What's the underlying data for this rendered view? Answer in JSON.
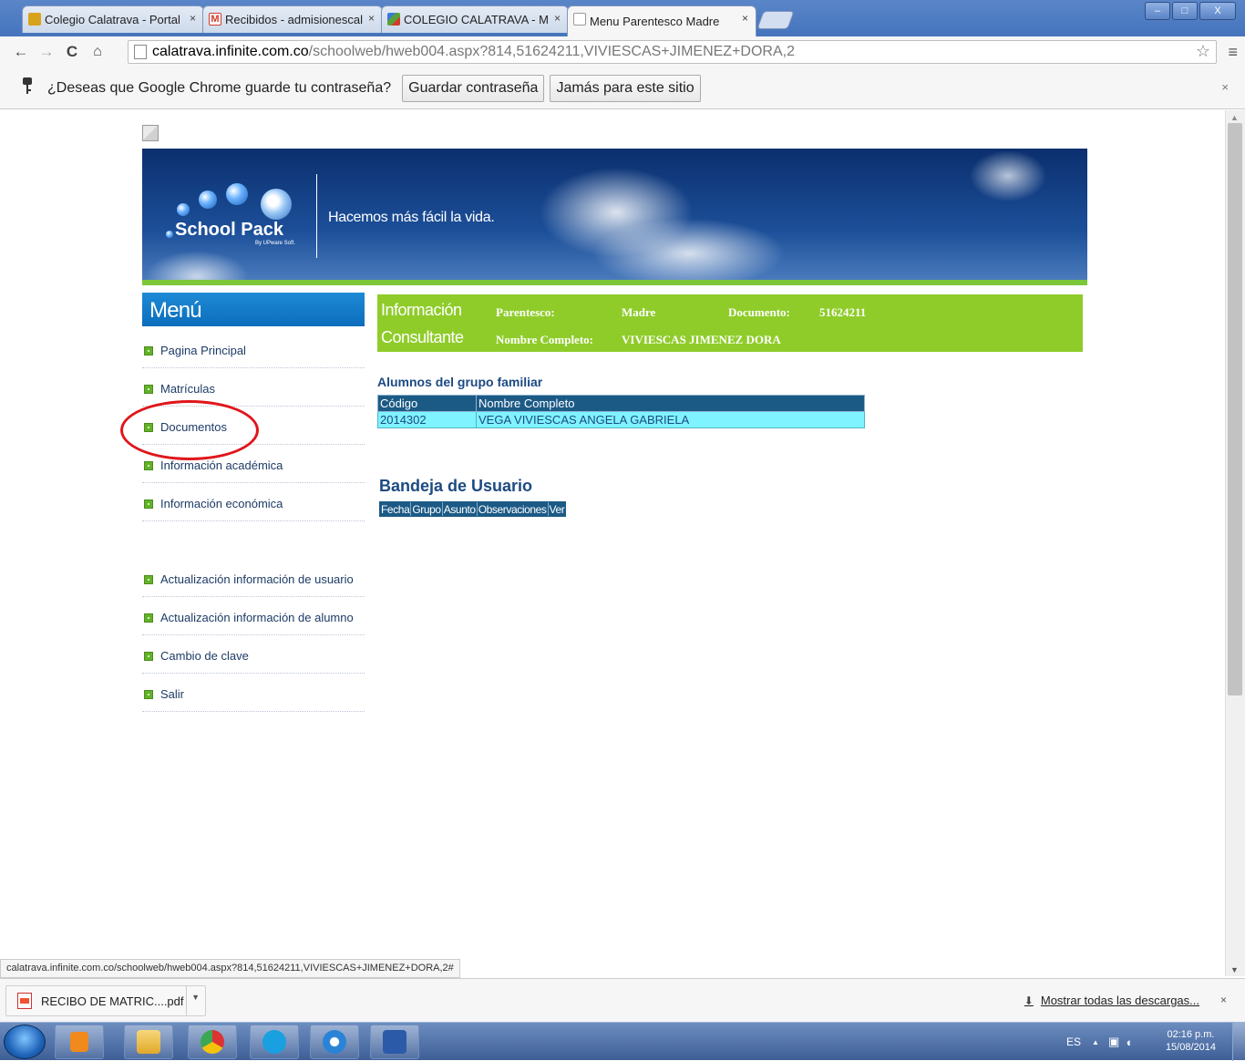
{
  "browser": {
    "tabs": [
      {
        "label": "Colegio Calatrava - Portal",
        "favicon_color": "#d9a21b"
      },
      {
        "label": "Recibidos - admisionescal",
        "favicon_color": "#d23b2a"
      },
      {
        "label": "COLEGIO CALATRAVA - M",
        "favicon_color": "#5aa03a"
      },
      {
        "label": "Menu Parentesco Madre",
        "favicon_color": "#ffffff"
      }
    ],
    "tab_close_glyph": "×",
    "window_buttons": {
      "minimize": "–",
      "maximize": "□",
      "close": "X"
    },
    "url_host": "calatrava.infinite.com.co",
    "url_path": "/schoolweb/hweb004.aspx?814,51624211,VIVIESCAS+JIMENEZ+DORA,2",
    "infobar": {
      "message": "¿Deseas que Google Chrome guarde tu contraseña?",
      "save_label": "Guardar contraseña",
      "never_label": "Jamás para este sitio",
      "close_glyph": "×"
    }
  },
  "banner": {
    "logo_text": "School Pack",
    "logo_sub": "By UPware Soft.",
    "tagline": "Hacemos más fácil la vida."
  },
  "menu": {
    "title": "Menú",
    "items": [
      {
        "label": "Pagina Principal"
      },
      {
        "label": "Matrículas"
      },
      {
        "label": "Documentos"
      },
      {
        "label": "Información académica"
      },
      {
        "label": "Información económica"
      },
      {
        "label": "Actualización información de usuario"
      },
      {
        "label": "Actualización información de alumno"
      },
      {
        "label": "Cambio de clave"
      },
      {
        "label": "Salir"
      }
    ]
  },
  "info": {
    "title_line1": "Información",
    "title_line2": "Consultante",
    "parentesco_label": "Parentesco:",
    "parentesco_value": "Madre",
    "documento_label": "Documento:",
    "documento_value": "51624211",
    "nombre_label": "Nombre Completo:",
    "nombre_value": "VIVIESCAS JIMENEZ DORA"
  },
  "students": {
    "title": "Alumnos del grupo familiar",
    "columns": [
      "Código",
      "Nombre Completo"
    ],
    "rows": [
      [
        "2014302",
        "VEGA VIVIESCAS ANGELA GABRIELA"
      ]
    ]
  },
  "inbox": {
    "title": "Bandeja de Usuario",
    "columns": [
      "Fecha",
      "Grupo",
      "Asunto",
      "Observaciones",
      "Ver"
    ]
  },
  "status_url": "calatrava.infinite.com.co/schoolweb/hweb004.aspx?814,51624211,VIVIESCAS+JIMENEZ+DORA,2#",
  "downloads": {
    "file": "RECIBO DE MATRIC....pdf",
    "show_all": "Mostrar todas las descargas...",
    "close_glyph": "×"
  },
  "taskbar": {
    "language": "ES",
    "time": "02:16 p.m.",
    "date": "15/08/2014"
  }
}
